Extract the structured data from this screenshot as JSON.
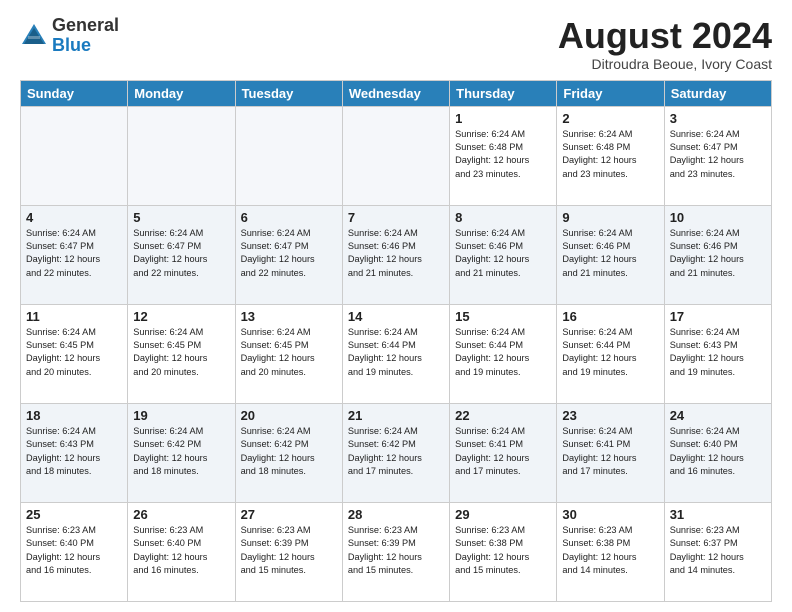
{
  "header": {
    "logo_general": "General",
    "logo_blue": "Blue",
    "month_title": "August 2024",
    "location": "Ditroudra Beoue, Ivory Coast"
  },
  "days_of_week": [
    "Sunday",
    "Monday",
    "Tuesday",
    "Wednesday",
    "Thursday",
    "Friday",
    "Saturday"
  ],
  "weeks": [
    [
      {
        "day": "",
        "info": ""
      },
      {
        "day": "",
        "info": ""
      },
      {
        "day": "",
        "info": ""
      },
      {
        "day": "",
        "info": ""
      },
      {
        "day": "1",
        "info": "Sunrise: 6:24 AM\nSunset: 6:48 PM\nDaylight: 12 hours\nand 23 minutes."
      },
      {
        "day": "2",
        "info": "Sunrise: 6:24 AM\nSunset: 6:48 PM\nDaylight: 12 hours\nand 23 minutes."
      },
      {
        "day": "3",
        "info": "Sunrise: 6:24 AM\nSunset: 6:47 PM\nDaylight: 12 hours\nand 23 minutes."
      }
    ],
    [
      {
        "day": "4",
        "info": "Sunrise: 6:24 AM\nSunset: 6:47 PM\nDaylight: 12 hours\nand 22 minutes."
      },
      {
        "day": "5",
        "info": "Sunrise: 6:24 AM\nSunset: 6:47 PM\nDaylight: 12 hours\nand 22 minutes."
      },
      {
        "day": "6",
        "info": "Sunrise: 6:24 AM\nSunset: 6:47 PM\nDaylight: 12 hours\nand 22 minutes."
      },
      {
        "day": "7",
        "info": "Sunrise: 6:24 AM\nSunset: 6:46 PM\nDaylight: 12 hours\nand 21 minutes."
      },
      {
        "day": "8",
        "info": "Sunrise: 6:24 AM\nSunset: 6:46 PM\nDaylight: 12 hours\nand 21 minutes."
      },
      {
        "day": "9",
        "info": "Sunrise: 6:24 AM\nSunset: 6:46 PM\nDaylight: 12 hours\nand 21 minutes."
      },
      {
        "day": "10",
        "info": "Sunrise: 6:24 AM\nSunset: 6:46 PM\nDaylight: 12 hours\nand 21 minutes."
      }
    ],
    [
      {
        "day": "11",
        "info": "Sunrise: 6:24 AM\nSunset: 6:45 PM\nDaylight: 12 hours\nand 20 minutes."
      },
      {
        "day": "12",
        "info": "Sunrise: 6:24 AM\nSunset: 6:45 PM\nDaylight: 12 hours\nand 20 minutes."
      },
      {
        "day": "13",
        "info": "Sunrise: 6:24 AM\nSunset: 6:45 PM\nDaylight: 12 hours\nand 20 minutes."
      },
      {
        "day": "14",
        "info": "Sunrise: 6:24 AM\nSunset: 6:44 PM\nDaylight: 12 hours\nand 19 minutes."
      },
      {
        "day": "15",
        "info": "Sunrise: 6:24 AM\nSunset: 6:44 PM\nDaylight: 12 hours\nand 19 minutes."
      },
      {
        "day": "16",
        "info": "Sunrise: 6:24 AM\nSunset: 6:44 PM\nDaylight: 12 hours\nand 19 minutes."
      },
      {
        "day": "17",
        "info": "Sunrise: 6:24 AM\nSunset: 6:43 PM\nDaylight: 12 hours\nand 19 minutes."
      }
    ],
    [
      {
        "day": "18",
        "info": "Sunrise: 6:24 AM\nSunset: 6:43 PM\nDaylight: 12 hours\nand 18 minutes."
      },
      {
        "day": "19",
        "info": "Sunrise: 6:24 AM\nSunset: 6:42 PM\nDaylight: 12 hours\nand 18 minutes."
      },
      {
        "day": "20",
        "info": "Sunrise: 6:24 AM\nSunset: 6:42 PM\nDaylight: 12 hours\nand 18 minutes."
      },
      {
        "day": "21",
        "info": "Sunrise: 6:24 AM\nSunset: 6:42 PM\nDaylight: 12 hours\nand 17 minutes."
      },
      {
        "day": "22",
        "info": "Sunrise: 6:24 AM\nSunset: 6:41 PM\nDaylight: 12 hours\nand 17 minutes."
      },
      {
        "day": "23",
        "info": "Sunrise: 6:24 AM\nSunset: 6:41 PM\nDaylight: 12 hours\nand 17 minutes."
      },
      {
        "day": "24",
        "info": "Sunrise: 6:24 AM\nSunset: 6:40 PM\nDaylight: 12 hours\nand 16 minutes."
      }
    ],
    [
      {
        "day": "25",
        "info": "Sunrise: 6:23 AM\nSunset: 6:40 PM\nDaylight: 12 hours\nand 16 minutes."
      },
      {
        "day": "26",
        "info": "Sunrise: 6:23 AM\nSunset: 6:40 PM\nDaylight: 12 hours\nand 16 minutes."
      },
      {
        "day": "27",
        "info": "Sunrise: 6:23 AM\nSunset: 6:39 PM\nDaylight: 12 hours\nand 15 minutes."
      },
      {
        "day": "28",
        "info": "Sunrise: 6:23 AM\nSunset: 6:39 PM\nDaylight: 12 hours\nand 15 minutes."
      },
      {
        "day": "29",
        "info": "Sunrise: 6:23 AM\nSunset: 6:38 PM\nDaylight: 12 hours\nand 15 minutes."
      },
      {
        "day": "30",
        "info": "Sunrise: 6:23 AM\nSunset: 6:38 PM\nDaylight: 12 hours\nand 14 minutes."
      },
      {
        "day": "31",
        "info": "Sunrise: 6:23 AM\nSunset: 6:37 PM\nDaylight: 12 hours\nand 14 minutes."
      }
    ]
  ]
}
